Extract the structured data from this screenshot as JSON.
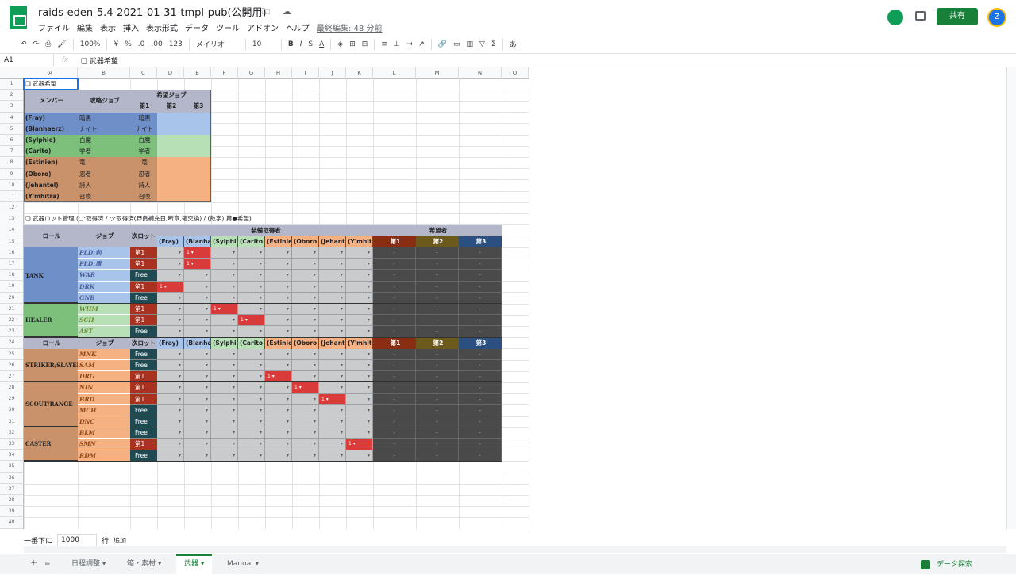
{
  "header": {
    "title": "raids-eden-5.4-2021-01-31-tmpl-pub(公開用)",
    "title_icons": "☆ 🗀 ☁",
    "menu": [
      "ファイル",
      "編集",
      "表示",
      "挿入",
      "表示形式",
      "データ",
      "ツール",
      "アドオン",
      "ヘルプ"
    ],
    "last_edit": "最終編集: 48 分前",
    "share_label": "共有",
    "avatar_letter": "Z"
  },
  "toolbar": {
    "undo": "↶",
    "redo": "↷",
    "print": "⎙",
    "paint": "🖌",
    "zoom": "100%",
    "currency": "¥",
    "percent": "%",
    "dec_less": ".0",
    "dec_more": ".00",
    "format": "123",
    "font": "メイリオ",
    "size": "10",
    "bold": "B",
    "italic": "I",
    "strike": "S",
    "color": "A",
    "input_tools": "あ"
  },
  "formula": {
    "cell_ref": "A1",
    "fx": "fx",
    "value": "❏ 武器希望"
  },
  "columns": [
    "A",
    "B",
    "C",
    "D",
    "E",
    "F",
    "G",
    "H",
    "I",
    "J",
    "K",
    "L",
    "M",
    "N",
    "O"
  ],
  "rows": [
    "1",
    "2",
    "3",
    "4",
    "5",
    "6",
    "7",
    "8",
    "9",
    "10",
    "11",
    "12",
    "13",
    "14",
    "15",
    "16",
    "17",
    "18",
    "19",
    "20",
    "21",
    "22",
    "23",
    "24",
    "25",
    "26",
    "27",
    "28",
    "29",
    "30",
    "31",
    "32",
    "33",
    "34",
    "35",
    "36",
    "37",
    "38",
    "39",
    "40"
  ],
  "section1": {
    "title": "❏ 武器希望",
    "member_header": "メンバー",
    "job_header": "攻略ジョブ",
    "hope_header": "希望ジョブ",
    "pref_headers": [
      "第1",
      "第2",
      "第3"
    ],
    "members": [
      {
        "name": "(Fray)",
        "job": "暗黒",
        "p1": "暗黒"
      },
      {
        "name": "(Blanhaerz)",
        "job": "ナイト",
        "p1": "ナイト"
      },
      {
        "name": "(Sylphie)",
        "job": "白魔",
        "p1": "白魔"
      },
      {
        "name": "(Carito)",
        "job": "学者",
        "p1": "学者"
      },
      {
        "name": "(Estinien)",
        "job": "竜",
        "p1": "竜"
      },
      {
        "name": "(Oboro)",
        "job": "忍者",
        "p1": "忍者"
      },
      {
        "name": "(Jehantel)",
        "job": "詩人",
        "p1": "詩人"
      },
      {
        "name": "(Y'mhitra)",
        "job": "召喚",
        "p1": "召喚"
      }
    ]
  },
  "section2": {
    "title": "❏ 武器ロット管理 (○:取得済 / ◇:取得済(野良補充日,断章,箱交換) / (数字):第●希望)",
    "role_header": "ロール",
    "job_header": "ジョブ",
    "next_lot_header": "次ロット",
    "equip_header": "装備取得者",
    "hope_header": "希望者",
    "member_cols": [
      "(Fray)",
      "(Blanha",
      "(Sylphi",
      "(Carito",
      "(Estinie",
      "(Oboro",
      "(Jehant",
      "(Y'mhit"
    ],
    "hope_cols": [
      "第1",
      "第2",
      "第3"
    ],
    "roles": [
      {
        "name": "Tank",
        "jobs": [
          {
            "job": "PLD:剣",
            "slot": "第1",
            "mark": {
              "col": 1,
              "val": "1"
            }
          },
          {
            "job": "PLD:盾",
            "slot": "第1",
            "mark": {
              "col": 1,
              "val": "1"
            }
          },
          {
            "job": "WAR",
            "slot": "Free"
          },
          {
            "job": "DRK",
            "slot": "第1",
            "mark": {
              "col": 0,
              "val": "1"
            }
          },
          {
            "job": "GNB",
            "slot": "Free"
          }
        ]
      },
      {
        "name": "Healer",
        "jobs": [
          {
            "job": "WHM",
            "slot": "第1",
            "mark": {
              "col": 2,
              "val": "1"
            }
          },
          {
            "job": "SCH",
            "slot": "第1",
            "mark": {
              "col": 3,
              "val": "1"
            }
          },
          {
            "job": "AST",
            "slot": "Free"
          }
        ]
      },
      {
        "name": "Striker/Slayer",
        "jobs": [
          {
            "job": "MNK",
            "slot": "Free"
          },
          {
            "job": "SAM",
            "slot": "Free"
          },
          {
            "job": "DRG",
            "slot": "第1",
            "mark": {
              "col": 4,
              "val": "1"
            }
          }
        ]
      },
      {
        "name": "Scout/Range",
        "jobs": [
          {
            "job": "NIN",
            "slot": "第1",
            "mark": {
              "col": 5,
              "val": "1"
            }
          },
          {
            "job": "BRD",
            "slot": "第1",
            "mark": {
              "col": 6,
              "val": "1"
            }
          },
          {
            "job": "MCH",
            "slot": "Free"
          },
          {
            "job": "DNC",
            "slot": "Free"
          }
        ]
      },
      {
        "name": "Caster",
        "jobs": [
          {
            "job": "BLM",
            "slot": "Free"
          },
          {
            "job": "SMN",
            "slot": "第1",
            "mark": {
              "col": 7,
              "val": "1"
            }
          },
          {
            "job": "RDM",
            "slot": "Free"
          }
        ]
      }
    ],
    "hope_value": "-"
  },
  "bottom": {
    "add_prefix": "一番下に",
    "add_count": "1000",
    "add_unit": "行",
    "add_button": "追加",
    "tabs": [
      "日程調整",
      "箱・素材",
      "武器",
      "Manual"
    ],
    "active_tab": "武器",
    "explore": "データ探索"
  },
  "colors": {
    "tank": "#6f8fc9",
    "healer": "#7cc07c",
    "dps": "#c9926a",
    "slot_first": "#a8321f",
    "slot_free": "#1f4a52",
    "mark": "#d93a3a",
    "hope1": "#8b2d12",
    "hope2": "#6b5a1c",
    "hope3": "#2a4f80"
  }
}
